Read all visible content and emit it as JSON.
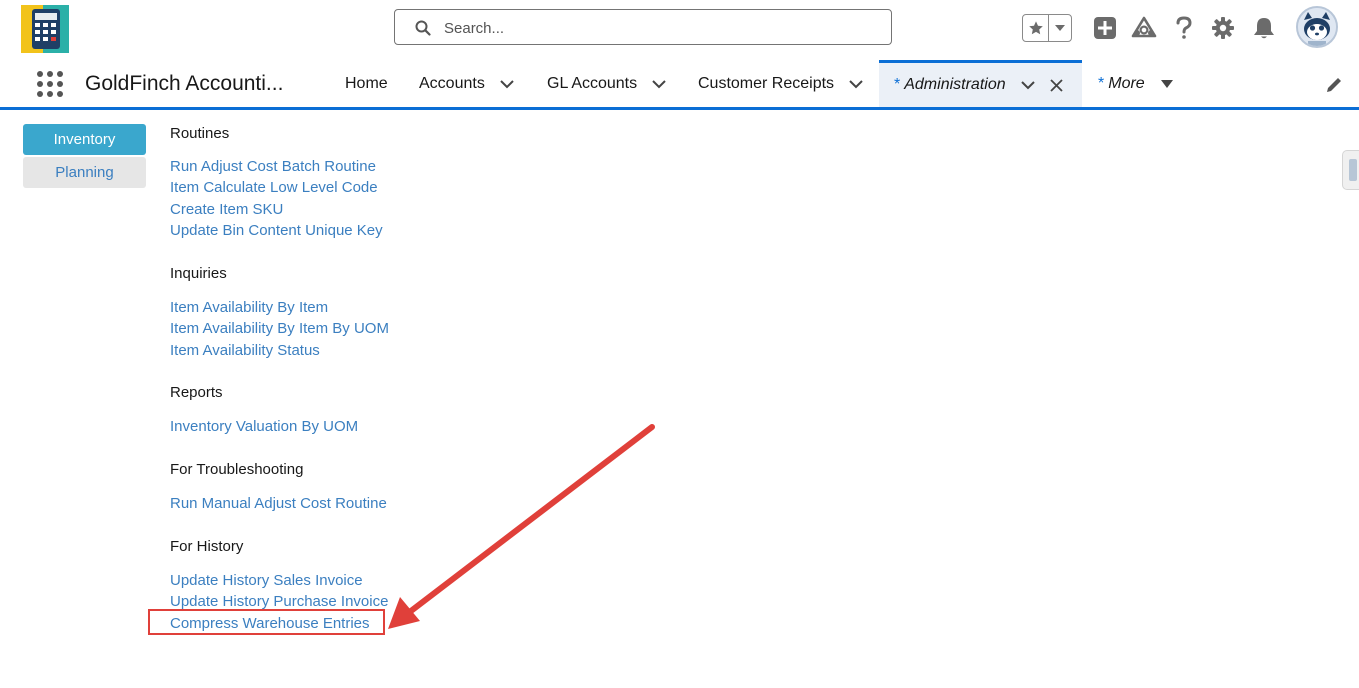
{
  "header": {
    "search": {
      "placeholder": "Search..."
    },
    "icons": [
      "star-icon",
      "dropdown-icon",
      "add-icon",
      "trailhead-icon",
      "help-icon",
      "setup-gear-icon",
      "notification-bell-icon",
      "avatar"
    ]
  },
  "nav": {
    "app_name": "GoldFinch Accounti...",
    "items": [
      {
        "label": "Home"
      },
      {
        "label": "Accounts"
      },
      {
        "label": "GL Accounts"
      },
      {
        "label": "Customer Receipts"
      },
      {
        "label": "Administration",
        "prefix": "*"
      },
      {
        "label": "More",
        "prefix": "*"
      }
    ]
  },
  "sidebar": {
    "tabs": [
      {
        "label": "Inventory"
      },
      {
        "label": "Planning"
      }
    ]
  },
  "sections": [
    {
      "title": "Routines",
      "links": [
        "Run Adjust Cost Batch Routine",
        "Item Calculate Low Level Code",
        "Create Item SKU",
        "Update Bin Content Unique Key"
      ]
    },
    {
      "title": "Inquiries",
      "links": [
        "Item Availability By Item",
        "Item Availability By Item By UOM",
        "Item Availability Status"
      ]
    },
    {
      "title": "Reports",
      "links": [
        "Inventory Valuation By UOM"
      ]
    },
    {
      "title": "For Troubleshooting",
      "links": [
        "Run Manual Adjust Cost Routine"
      ]
    },
    {
      "title": "For History",
      "links": [
        "Update History Sales Invoice",
        "Update History Purchase Invoice",
        "Compress Warehouse Entries"
      ]
    }
  ],
  "colors": {
    "brand_blue": "#0b6ed5",
    "link_blue": "#3b7fc0",
    "selected_tab": "#3aa7cd",
    "annotation_red": "#e0403a"
  }
}
